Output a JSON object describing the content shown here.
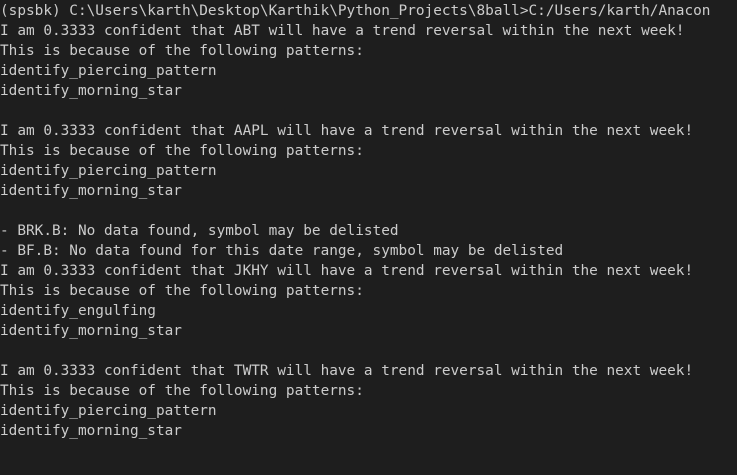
{
  "terminal": {
    "background": "#1e1e1e",
    "foreground": "#cccccc",
    "lines": [
      "(spsbk) C:\\Users\\karth\\Desktop\\Karthik\\Python_Projects\\8ball>C:/Users/karth/Anacon",
      "I am 0.3333 confident that ABT will have a trend reversal within the next week!",
      "This is because of the following patterns:",
      "identify_piercing_pattern",
      "identify_morning_star",
      "",
      "I am 0.3333 confident that AAPL will have a trend reversal within the next week!",
      "This is because of the following patterns:",
      "identify_piercing_pattern",
      "identify_morning_star",
      "",
      "- BRK.B: No data found, symbol may be delisted",
      "- BF.B: No data found for this date range, symbol may be delisted",
      "I am 0.3333 confident that JKHY will have a trend reversal within the next week!",
      "This is because of the following patterns:",
      "identify_engulfing",
      "identify_morning_star",
      "",
      "I am 0.3333 confident that TWTR will have a trend reversal within the next week!",
      "This is because of the following patterns:",
      "identify_piercing_pattern",
      "identify_morning_star"
    ]
  }
}
